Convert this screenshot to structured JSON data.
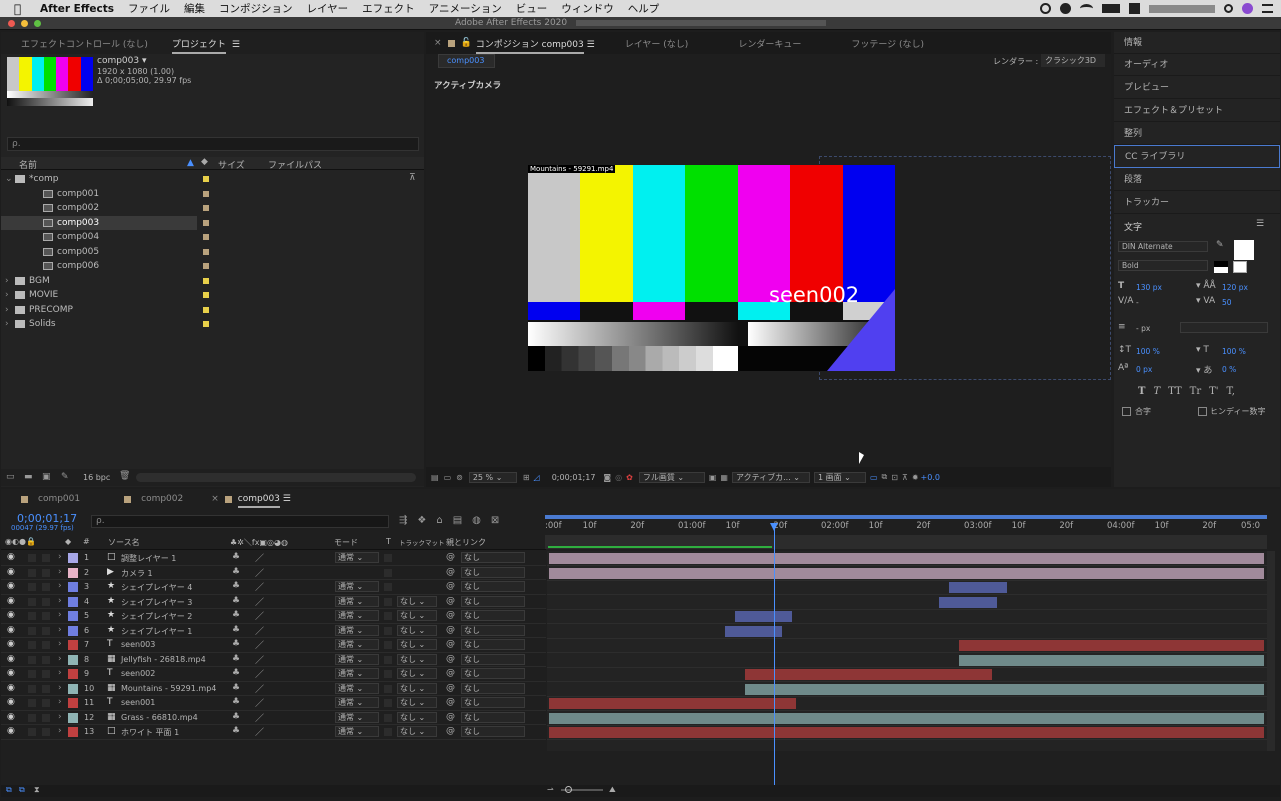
{
  "menubar": {
    "app": "After Effects",
    "items": [
      "ファイル",
      "編集",
      "コンポジション",
      "レイヤー",
      "エフェクト",
      "アニメーション",
      "ビュー",
      "ウィンドウ",
      "ヘルプ"
    ]
  },
  "window": {
    "title": "Adobe After Effects 2020"
  },
  "project": {
    "tabs": [
      "エフェクトコントロール (なし)",
      "プロジェクト"
    ],
    "comp_name": "comp003 ▾",
    "comp_info1": "1920 x 1080 (1.00)",
    "comp_info2": "Δ 0;00;05;00, 29.97 fps",
    "search_placeholder": "ρ.",
    "cols": [
      "名前",
      "サイズ",
      "ファイルパス"
    ],
    "bpc": "16 bpc",
    "items": [
      {
        "name": "*comp",
        "type": "folder",
        "open": true,
        "color": "#e8d04a"
      },
      {
        "name": "comp001",
        "type": "comp",
        "color": "#b9a27d"
      },
      {
        "name": "comp002",
        "type": "comp",
        "color": "#b9a27d"
      },
      {
        "name": "comp003",
        "type": "comp",
        "color": "#b9a27d",
        "selected": true
      },
      {
        "name": "comp004",
        "type": "comp",
        "color": "#b9a27d"
      },
      {
        "name": "comp005",
        "type": "comp",
        "color": "#b9a27d"
      },
      {
        "name": "comp006",
        "type": "comp",
        "color": "#b9a27d"
      },
      {
        "name": "BGM",
        "type": "folder",
        "color": "#e8d04a"
      },
      {
        "name": "MOVIE",
        "type": "folder",
        "color": "#e8d04a"
      },
      {
        "name": "PRECOMP",
        "type": "folder",
        "color": "#e8d04a"
      },
      {
        "name": "Solids",
        "type": "folder",
        "color": "#e8d04a"
      }
    ]
  },
  "comp_viewer": {
    "tabs": [
      "コンポジション comp003",
      "レイヤー (なし)",
      "レンダーキュー",
      "フッテージ (なし)"
    ],
    "subtab": "comp003",
    "renderer_label": "レンダラー :",
    "renderer": "クラシック3D",
    "camera": "アクティブカメラ",
    "layer_label": "Mountains - 59291.mp4",
    "text_overlay": "seen002",
    "toolbar": {
      "zoom": "25 %",
      "time": "0;00;01;17",
      "quality": "フル画質",
      "view": "アクティブカ...",
      "views": "1 画面",
      "offset": "+0.0"
    }
  },
  "right": {
    "items": [
      "情報",
      "オーディオ",
      "プレビュー",
      "エフェクト＆プリセット",
      "整列",
      "CC ライブラリ",
      "段落",
      "トラッカー"
    ],
    "char_title": "文字",
    "font": "DIN Alternate",
    "style": "Bold",
    "size": "130 px",
    "leading": "120 px",
    "tracking": "50",
    "kern": "-",
    "linesp": "- px",
    "vscale": "100 %",
    "hscale": "100 %",
    "baseline": "0 px",
    "tsume": "0 %",
    "ligature": "合字",
    "hindi": "ヒンディー数字",
    "format_btns": [
      "T",
      "T",
      "TT",
      "Tr",
      "T'",
      "T,"
    ]
  },
  "timeline": {
    "tabs": [
      "comp001",
      "comp002",
      "comp003"
    ],
    "current_time": "0;00;01;17",
    "frame": "00047 (29.97 fps)",
    "search_placeholder": "ρ.",
    "col_source": "ソース名",
    "col_mode": "モード",
    "col_t": "T",
    "col_track": "トラックマット",
    "col_parent": "親とリンク",
    "ruler": [
      ":00f",
      "10f",
      "20f",
      "01:00f",
      "10f",
      "20f",
      "02:00f",
      "10f",
      "20f",
      "03:00f",
      "10f",
      "20f",
      "04:00f",
      "10f",
      "20f",
      "05:0"
    ],
    "layers": [
      {
        "num": "1",
        "name": "調整レイヤー 1",
        "icon": "adj",
        "label": "#a8a8e8",
        "mode": "通常",
        "track": "",
        "parent": "なし",
        "bar": {
          "s": 0,
          "e": 5.0,
          "c": "#a18a9b"
        }
      },
      {
        "num": "2",
        "name": "カメラ 1",
        "icon": "cam",
        "label": "#e8b4c8",
        "mode": "",
        "track": "",
        "parent": "なし",
        "bar": {
          "s": 0,
          "e": 5.0,
          "c": "#a18a9b"
        }
      },
      {
        "num": "3",
        "name": "シェイプレイヤー 4",
        "icon": "star",
        "label": "#6f7ee0",
        "mode": "通常",
        "track": "",
        "parent": "なし",
        "bar": {
          "s": 2.8,
          "e": 3.2,
          "c": "#4f5a98"
        }
      },
      {
        "num": "4",
        "name": "シェイプレイヤー 3",
        "icon": "star",
        "label": "#6f7ee0",
        "mode": "通常",
        "track": "なし",
        "parent": "なし",
        "bar": {
          "s": 2.73,
          "e": 3.13,
          "c": "#4f5a98"
        }
      },
      {
        "num": "5",
        "name": "シェイプレイヤー 2",
        "icon": "star",
        "label": "#6f7ee0",
        "mode": "通常",
        "track": "なし",
        "parent": "なし",
        "bar": {
          "s": 1.3,
          "e": 1.7,
          "c": "#4f5a98"
        }
      },
      {
        "num": "6",
        "name": "シェイプレイヤー 1",
        "icon": "star",
        "label": "#6f7ee0",
        "mode": "通常",
        "track": "なし",
        "parent": "なし",
        "bar": {
          "s": 1.23,
          "e": 1.63,
          "c": "#4f5a98"
        }
      },
      {
        "num": "7",
        "name": "seen003",
        "icon": "T",
        "label": "#c04040",
        "mode": "通常",
        "track": "なし",
        "parent": "なし",
        "bar": {
          "s": 2.87,
          "e": 5.0,
          "c": "#8e3636"
        }
      },
      {
        "num": "8",
        "name": "Jellyfish - 26818.mp4",
        "icon": "vid",
        "label": "#8fb4b4",
        "mode": "通常",
        "track": "なし",
        "parent": "なし",
        "bar": {
          "s": 2.87,
          "e": 5.0,
          "c": "#6f8a8a"
        }
      },
      {
        "num": "9",
        "name": "seen002",
        "icon": "T",
        "label": "#c04040",
        "mode": "通常",
        "track": "なし",
        "parent": "なし",
        "bar": {
          "s": 1.37,
          "e": 3.1,
          "c": "#8e3636"
        }
      },
      {
        "num": "10",
        "name": "Mountains - 59291.mp4",
        "icon": "vid",
        "label": "#8fb4b4",
        "mode": "通常",
        "track": "なし",
        "parent": "なし",
        "bar": {
          "s": 1.37,
          "e": 5.0,
          "c": "#6f8a8a"
        }
      },
      {
        "num": "11",
        "name": "seen001",
        "icon": "T",
        "label": "#c04040",
        "mode": "通常",
        "track": "なし",
        "parent": "なし",
        "bar": {
          "s": 0,
          "e": 1.73,
          "c": "#8e3636"
        }
      },
      {
        "num": "12",
        "name": "Grass - 66810.mp4",
        "icon": "vid",
        "label": "#8fb4b4",
        "mode": "通常",
        "track": "なし",
        "parent": "なし",
        "bar": {
          "s": 0,
          "e": 5.0,
          "c": "#6f8a8a"
        }
      },
      {
        "num": "13",
        "name": "ホワイト 平面 1",
        "icon": "solid",
        "label": "#c04040",
        "mode": "通常",
        "track": "なし",
        "parent": "なし",
        "bar": {
          "s": 0,
          "e": 5.0,
          "c": "#8e3636"
        }
      }
    ],
    "playhead_sec": 1.57,
    "work_end_sec": 1.57
  }
}
